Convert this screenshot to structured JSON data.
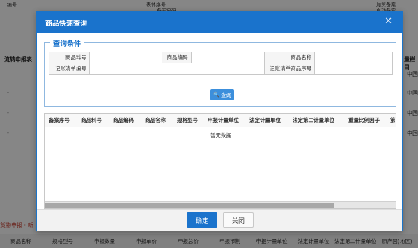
{
  "background": {
    "top_cells": [
      "编号",
      "表体序号",
      "加贸备案",
      "备案号码",
      "自动备案"
    ],
    "side_labels": {
      "left": "流转申报表",
      "right": "量栏目"
    },
    "dash": "-",
    "cn": "中国",
    "red_note": "货物申报 · 新",
    "footer_columns": [
      "商品名称",
      "规格型号",
      "申报数量",
      "申报单价",
      "申报总价",
      "申报币制",
      "申报计量单位",
      "法定计量单位",
      "法定第二计量单位",
      "原产国(地区)"
    ]
  },
  "dialog": {
    "title": "商品快速查询",
    "close_icon": "close-icon",
    "conditions": {
      "legend": "查询条件",
      "labels": {
        "item_no": "商品料号",
        "code": "商品编码",
        "name": "商品名称",
        "record_no": "记账清单编号",
        "record_seq": "记账清单商品序号"
      }
    },
    "query_button": {
      "label": "查询",
      "icon": "search-icon"
    },
    "grid": {
      "columns": [
        "备案序号",
        "商品料号",
        "商品编码",
        "商品名称",
        "规格型号",
        "申报计量单位",
        "法定计量单位",
        "法定第二计量单位",
        "重量比例因子",
        "第"
      ],
      "empty_text": "暂无数据",
      "scroll_fraction": 0.82
    },
    "footer": {
      "ok": "确定",
      "close": "关闭"
    },
    "colors": {
      "accent": "#1a73cc",
      "button": "#3c8fdc"
    }
  }
}
